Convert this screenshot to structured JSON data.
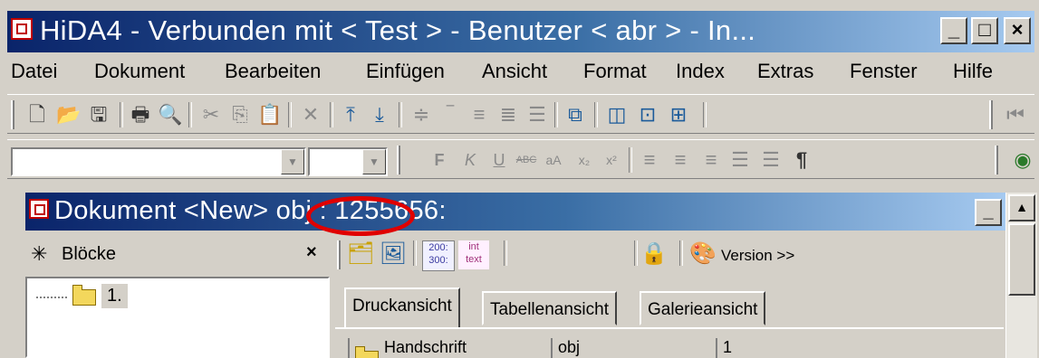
{
  "window": {
    "title": "HiDA4 - Verbunden mit < Test > - Benutzer < abr > - In...",
    "min_glyph": "_",
    "max_glyph": "□",
    "close_glyph": "×"
  },
  "menu": [
    "Datei",
    "Dokument",
    "Bearbeiten",
    "Einfügen",
    "Ansicht",
    "Format",
    "Index",
    "Extras",
    "Fenster",
    "Hilfe"
  ],
  "toolbar1": {
    "icons": [
      "new-icon",
      "open-icon",
      "save-icon",
      "print-icon",
      "print-preview-icon",
      "cut-icon",
      "copy-icon",
      "paste-icon",
      "delete-icon",
      "move-up-icon",
      "move-down-icon",
      "align-icon",
      "line-icon",
      "list-icon",
      "list2-icon",
      "numbered-list-icon",
      "network-icon",
      "window-icon",
      "search-window-icon",
      "tree-icon",
      "skip-icon"
    ]
  },
  "toolbar2": {
    "font_combo": "",
    "size_combo": "",
    "format_glyphs": {
      "bold": "F",
      "italic": "K",
      "underline": "U",
      "strike": "ABC",
      "case": "aA",
      "sub": "x₂",
      "sup": "x²",
      "para": "¶"
    }
  },
  "document_window": {
    "title": "Dokument <New> obj : 1255656:",
    "min_glyph": "_"
  },
  "left_panel": {
    "star": "✳",
    "label": "Blöcke",
    "close": "×",
    "tree_items": [
      {
        "label": "1."
      }
    ]
  },
  "doc_toolbar": {
    "num_text_top": "200:",
    "num_text_bottom": "300:",
    "int_text_top": "int",
    "int_text_bottom": "text",
    "version_label": "Version >>"
  },
  "tabs": [
    "Druckansicht",
    "Tabellenansicht",
    "Galerieansicht"
  ],
  "row": {
    "col1": "Handschrift",
    "col2": "obj",
    "col3": "1"
  },
  "colors": {
    "title_start": "#0a246a",
    "title_end": "#a6caf0",
    "highlight": "#e00000",
    "face": "#d4d0c8"
  }
}
